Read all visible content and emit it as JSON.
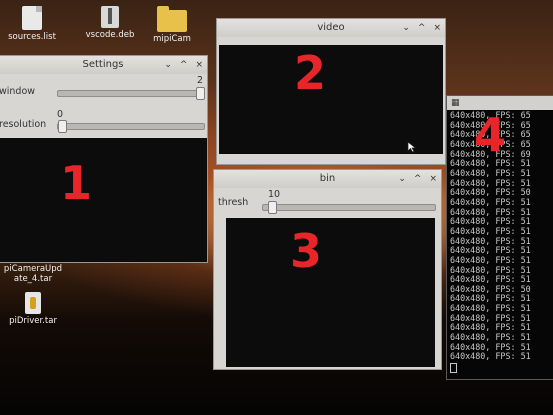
{
  "desktop": {
    "icons": [
      {
        "label": "sources.list"
      },
      {
        "label": "vscode.deb"
      },
      {
        "label": "mipiCam"
      },
      {
        "label": "piCameraUpdate_4.tar"
      },
      {
        "label": "piDriver.tar"
      }
    ]
  },
  "windows": {
    "settings": {
      "title": "Settings",
      "controls": [
        "⌄",
        "^",
        "×"
      ],
      "rows": [
        {
          "label": "window",
          "value": "2",
          "fraction": 1.0
        },
        {
          "label": "resolution",
          "value": "0",
          "fraction": 0.0
        }
      ]
    },
    "video": {
      "title": "video",
      "controls": [
        "⌄",
        "^",
        "×"
      ]
    },
    "bin": {
      "title": "bin",
      "controls": [
        "⌄",
        "^",
        "×"
      ],
      "rows": [
        {
          "label": "thresh",
          "value": "10",
          "fraction": 0.04
        }
      ]
    }
  },
  "terminal": {
    "top_icon": "▦",
    "lines": [
      "640x480, FPS: 65",
      "640x480, FPS: 65",
      "640x480, FPS: 65",
      "640x480, FPS: 65",
      "640x480, FPS: 69",
      "640x480, FPS: 51",
      "640x480, FPS: 51",
      "640x480, FPS: 51",
      "640x480, FPS: 50",
      "640x480, FPS: 51",
      "640x480, FPS: 51",
      "640x480, FPS: 51",
      "640x480, FPS: 51",
      "640x480, FPS: 51",
      "640x480, FPS: 51",
      "640x480, FPS: 51",
      "640x480, FPS: 51",
      "640x480, FPS: 51",
      "640x480, FPS: 50",
      "640x480, FPS: 51",
      "640x480, FPS: 51",
      "640x480, FPS: 51",
      "640x480, FPS: 51",
      "640x480, FPS: 51",
      "640x480, FPS: 51",
      "640x480, FPS: 51"
    ]
  },
  "annotations": [
    "1",
    "2",
    "3",
    "4"
  ],
  "colors": {
    "annotation": "#e8262a",
    "window_chrome": "#d8d6d2",
    "video_black": "#0c0c0c"
  }
}
